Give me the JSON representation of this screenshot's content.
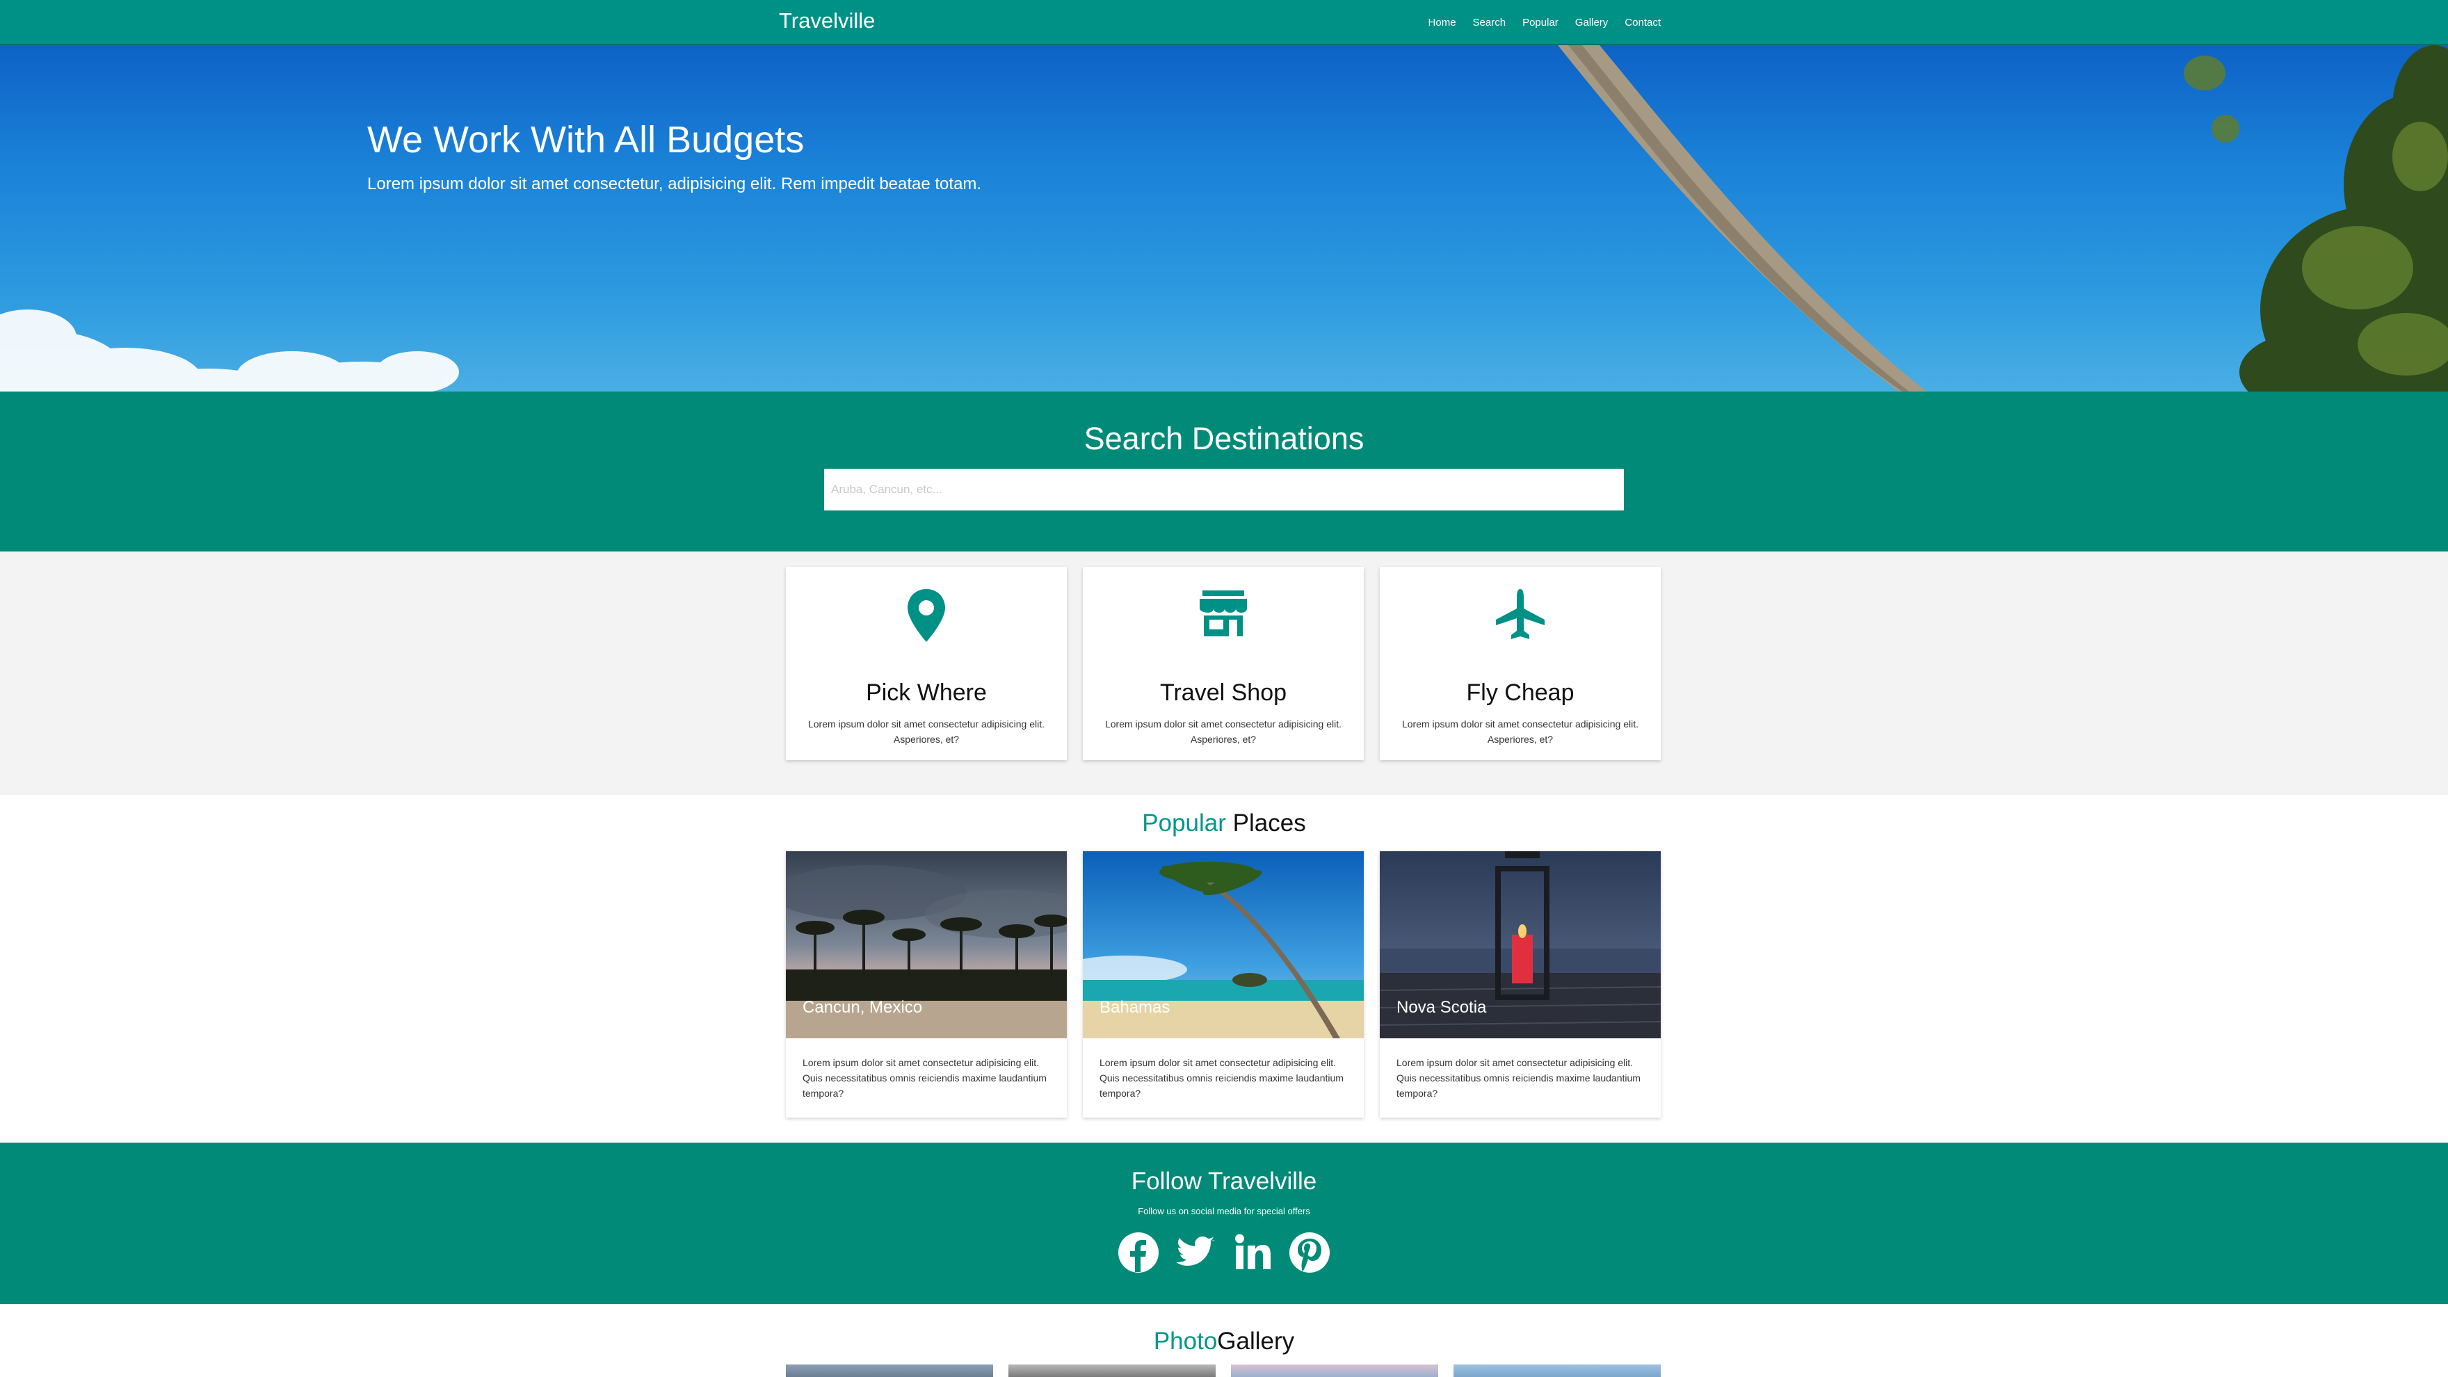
{
  "nav": {
    "brand": "Travelville",
    "links": [
      "Home",
      "Search",
      "Popular",
      "Gallery",
      "Contact"
    ]
  },
  "hero": {
    "title": "We Work With All Budgets",
    "subtitle": "Lorem ipsum dolor sit amet consectetur, adipisicing elit. Rem impedit beatae totam."
  },
  "search": {
    "title": "Search Destinations",
    "placeholder": "Aruba, Cancun, etc..."
  },
  "features": [
    {
      "icon": "map-pin-icon",
      "title": "Pick Where",
      "text": "Lorem ipsum dolor sit amet consectetur adipisicing elit. Asperiores, et?"
    },
    {
      "icon": "store-icon",
      "title": "Travel Shop",
      "text": "Lorem ipsum dolor sit amet consectetur adipisicing elit. Asperiores, et?"
    },
    {
      "icon": "airplane-icon",
      "title": "Fly Cheap",
      "text": "Lorem ipsum dolor sit amet consectetur adipisicing elit. Asperiores, et?"
    }
  ],
  "popular": {
    "title_accent": "Popular",
    "title_rest": " Places",
    "places": [
      {
        "name": "Cancun, Mexico",
        "text": "Lorem ipsum dolor sit amet consectetur adipisicing elit. Quis necessitatibus omnis reiciendis maxime laudantium tempora?"
      },
      {
        "name": "Bahamas",
        "text": "Lorem ipsum dolor sit amet consectetur adipisicing elit. Quis necessitatibus omnis reiciendis maxime laudantium tempora?"
      },
      {
        "name": "Nova Scotia",
        "text": "Lorem ipsum dolor sit amet consectetur adipisicing elit. Quis necessitatibus omnis reiciendis maxime laudantium tempora?"
      }
    ]
  },
  "follow": {
    "title": "Follow Travelville",
    "subtitle": "Follow us on social media for special offers",
    "icons": [
      "facebook-icon",
      "twitter-icon",
      "linkedin-icon",
      "pinterest-icon"
    ]
  },
  "gallery": {
    "title_accent": "Photo",
    "title_rest": "Gallery"
  },
  "colors": {
    "primary": "#009186",
    "section_teal": "#008a77",
    "accent_text": "#00968a",
    "light_bg": "#f3f3f3"
  }
}
